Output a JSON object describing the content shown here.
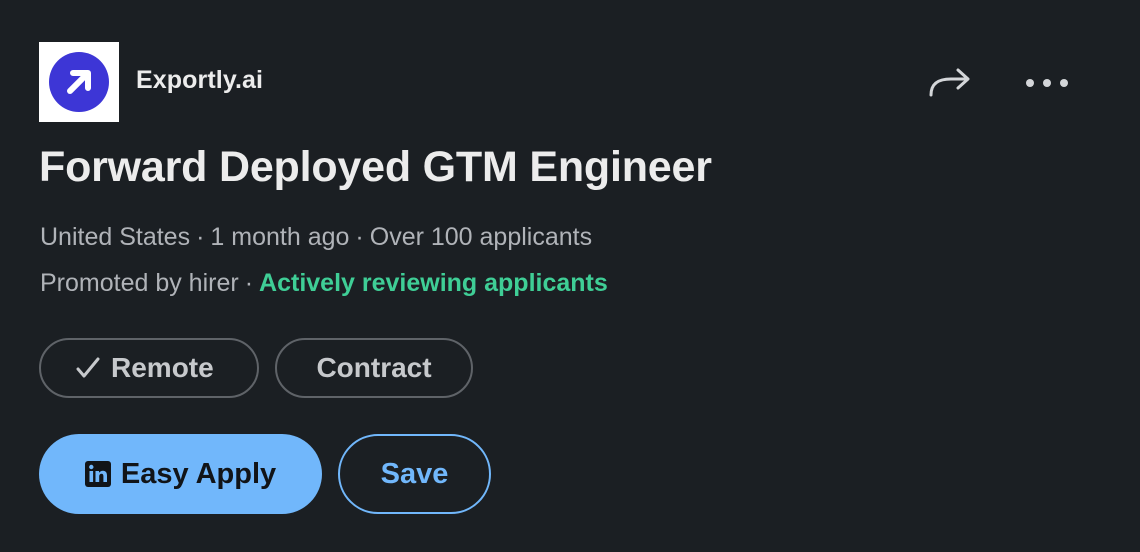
{
  "company": {
    "name": "Exportly.ai",
    "logo_icon": "arrow-up-right-icon",
    "logo_bg": "#3d36d6"
  },
  "actions": {
    "share_icon": "share-arrow-icon",
    "more_icon": "more-horizontal-icon"
  },
  "job": {
    "title": "Forward Deployed GTM Engineer",
    "location": "United States",
    "posted": "1 month ago",
    "applicants": "Over 100 applicants",
    "promoted": "Promoted by hirer",
    "status": "Actively reviewing applicants",
    "separator": "·"
  },
  "tags": {
    "remote": "Remote",
    "remote_icon": "checkmark-icon",
    "contract": "Contract"
  },
  "buttons": {
    "easy_apply": "Easy Apply",
    "easy_apply_icon": "linkedin-icon",
    "save": "Save"
  },
  "colors": {
    "background": "#1b1f23",
    "accent": "#71b7fb",
    "status_green": "#3fce96"
  }
}
